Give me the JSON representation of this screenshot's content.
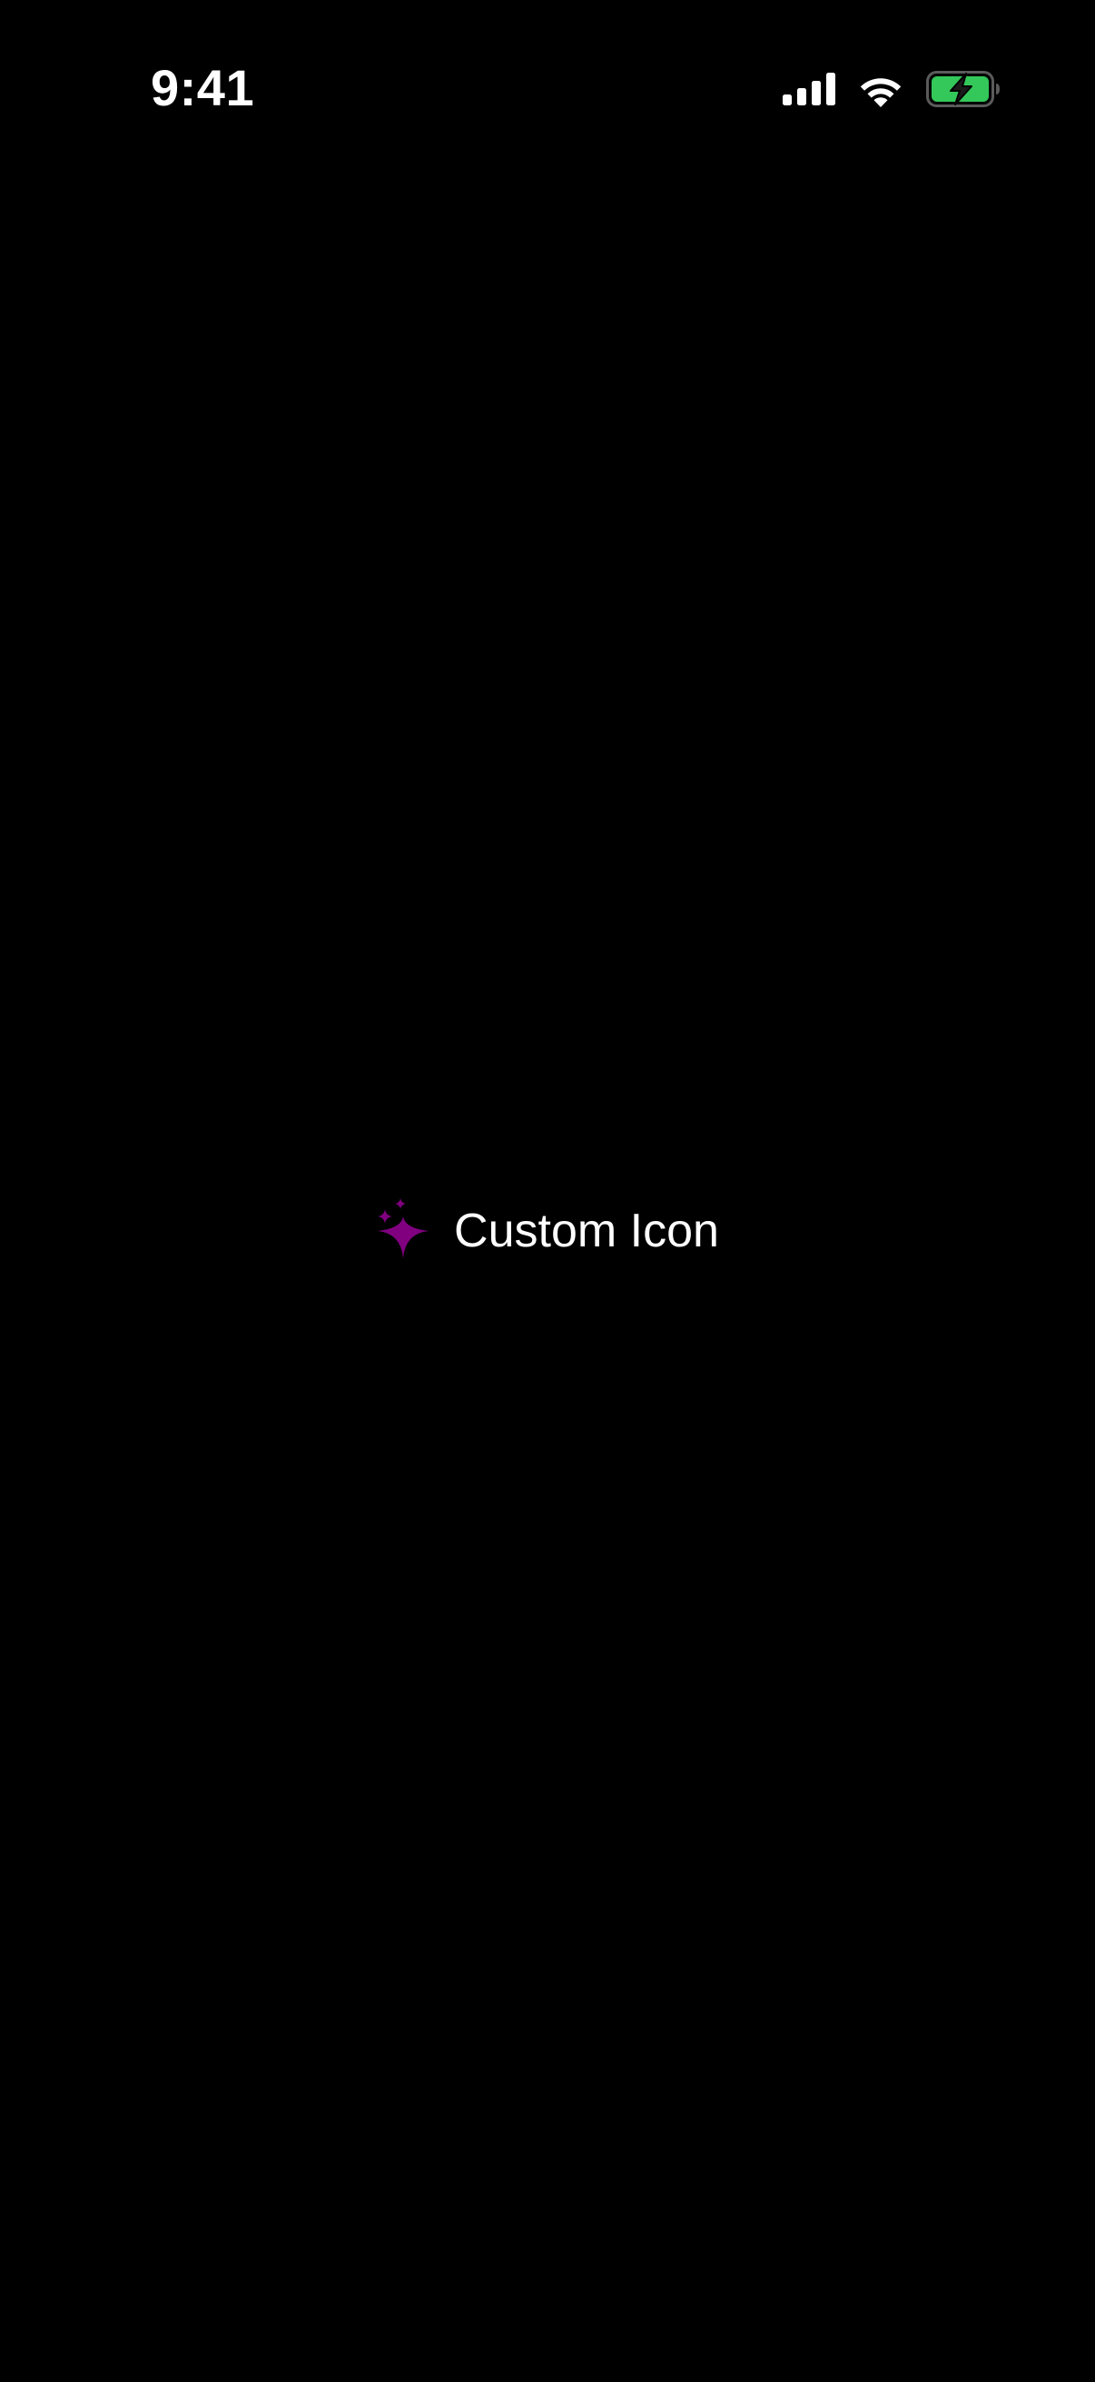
{
  "status_bar": {
    "time": "9:41",
    "icons": [
      "cellular-signal-icon",
      "wifi-icon",
      "battery-charging-icon"
    ],
    "battery_color": "#34C759"
  },
  "main": {
    "label": "Custom Icon",
    "icon": "sparkles-icon",
    "icon_color": "#800080"
  }
}
